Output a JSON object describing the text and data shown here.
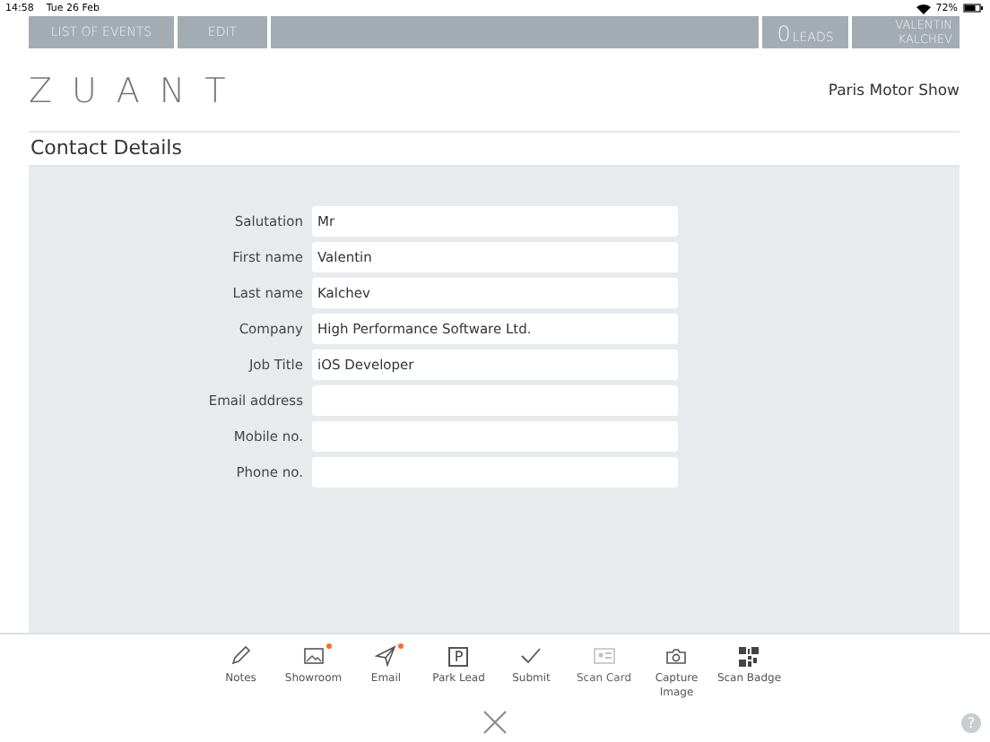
{
  "status_bar": {
    "time": "14:58",
    "date": "Tue 26 Feb",
    "battery": "72%"
  },
  "nav": {
    "tabs": [
      {
        "label": "LIST OF EVENTS"
      },
      {
        "label": "EDIT"
      }
    ],
    "leads_count": "0",
    "leads_label": "LEADS",
    "user": "VALENTIN KALCHEV"
  },
  "header": {
    "logo": "ZUANT",
    "event": "Paris Motor Show"
  },
  "section_title": "Contact Details",
  "fields": [
    {
      "label": "Salutation",
      "value": "Mr"
    },
    {
      "label": "First name",
      "value": "Valentin"
    },
    {
      "label": "Last name",
      "value": "Kalchev"
    },
    {
      "label": "Company",
      "value": "High Performance Software Ltd."
    },
    {
      "label": "Job Title",
      "value": "iOS Developer"
    },
    {
      "label": "Email address"
    },
    {
      "label": "Mobile no."
    },
    {
      "label": "Phone no."
    }
  ],
  "toolbar": [
    {
      "kind": "pencil",
      "label": "Notes",
      "badge": false,
      "disabled": false
    },
    {
      "kind": "image",
      "label": "Showroom",
      "badge": true,
      "disabled": false
    },
    {
      "kind": "send",
      "label": "Email",
      "badge": true,
      "disabled": false
    },
    {
      "kind": "park",
      "label": "Park Lead",
      "icon_text": "P",
      "badge": false,
      "disabled": false
    },
    {
      "kind": "check",
      "label": "Submit",
      "badge": false,
      "disabled": false
    },
    {
      "kind": "card",
      "label": "Scan Card",
      "badge": false,
      "disabled": true
    },
    {
      "kind": "camera",
      "label": "Capture Image",
      "badge": false,
      "disabled": false
    },
    {
      "kind": "qr",
      "label": "Scan Badge",
      "badge": false,
      "disabled": false
    }
  ],
  "help": "?"
}
